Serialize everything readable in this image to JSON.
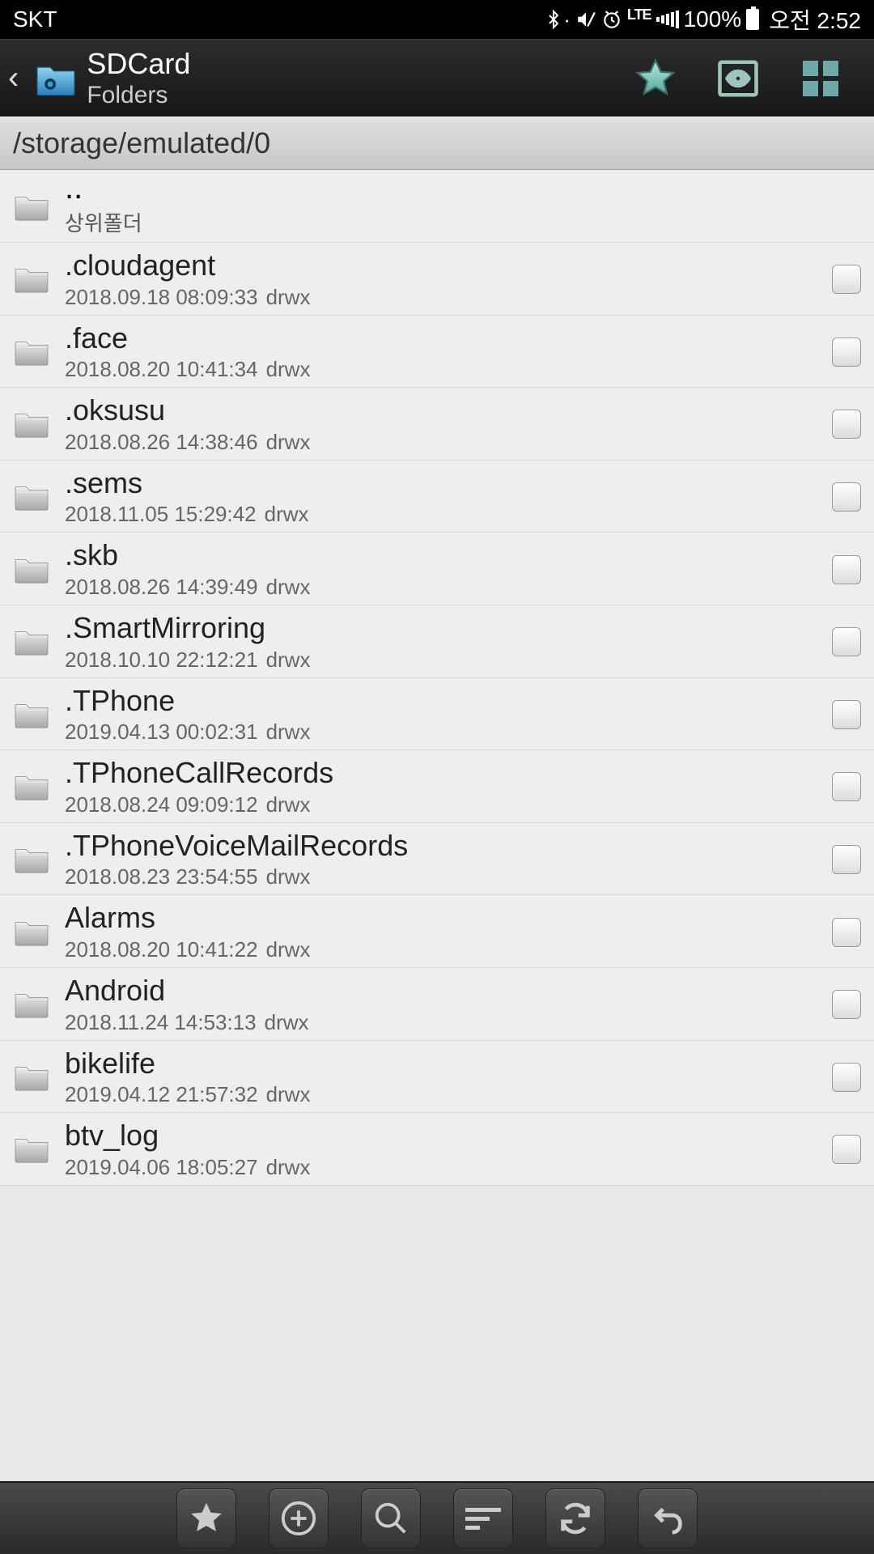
{
  "status": {
    "carrier": "SKT",
    "battery": "100%",
    "time": "오전 2:52",
    "net": "LTE"
  },
  "header": {
    "title": "SDCard",
    "subtitle": "Folders"
  },
  "path": "/storage/emulated/0",
  "parent": {
    "name": "..",
    "label": "상위폴더"
  },
  "items": [
    {
      "name": ".cloudagent",
      "date": "2018.09.18 08:09:33",
      "perm": "drwx"
    },
    {
      "name": ".face",
      "date": "2018.08.20 10:41:34",
      "perm": "drwx"
    },
    {
      "name": ".oksusu",
      "date": "2018.08.26 14:38:46",
      "perm": "drwx"
    },
    {
      "name": ".sems",
      "date": "2018.11.05 15:29:42",
      "perm": "drwx"
    },
    {
      "name": ".skb",
      "date": "2018.08.26 14:39:49",
      "perm": "drwx"
    },
    {
      "name": ".SmartMirroring",
      "date": "2018.10.10 22:12:21",
      "perm": "drwx"
    },
    {
      "name": ".TPhone",
      "date": "2019.04.13 00:02:31",
      "perm": "drwx"
    },
    {
      "name": ".TPhoneCallRecords",
      "date": "2018.08.24 09:09:12",
      "perm": "drwx"
    },
    {
      "name": ".TPhoneVoiceMailRecords",
      "date": "2018.08.23 23:54:55",
      "perm": "drwx"
    },
    {
      "name": "Alarms",
      "date": "2018.08.20 10:41:22",
      "perm": "drwx"
    },
    {
      "name": "Android",
      "date": "2018.11.24 14:53:13",
      "perm": "drwx"
    },
    {
      "name": "bikelife",
      "date": "2019.04.12 21:57:32",
      "perm": "drwx"
    },
    {
      "name": "btv_log",
      "date": "2019.04.06 18:05:27",
      "perm": "drwx"
    }
  ]
}
